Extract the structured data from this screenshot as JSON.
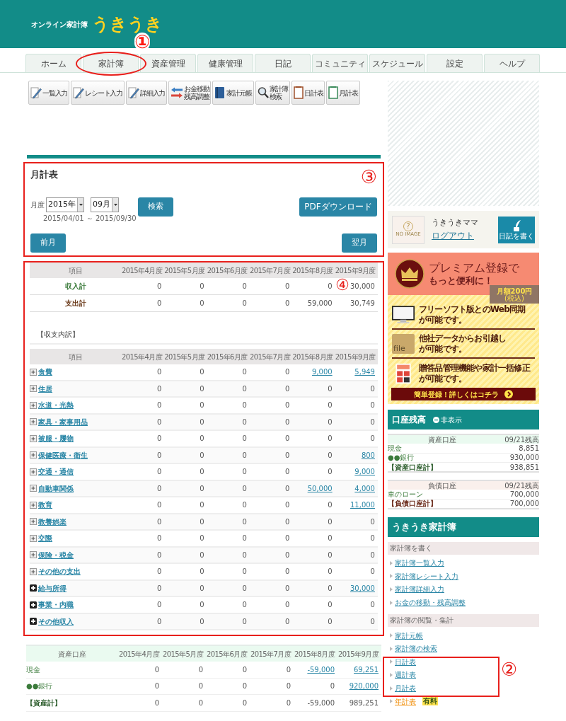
{
  "header": {
    "subtitle": "オンライン家計簿",
    "logo": "うきうき"
  },
  "tabs": [
    {
      "label": "ホーム"
    },
    {
      "label": "家計簿"
    },
    {
      "label": "資産管理"
    },
    {
      "label": "健康管理"
    },
    {
      "label": "日記"
    },
    {
      "label": "コミュニティ"
    },
    {
      "label": "スケジュール"
    },
    {
      "label": "設定"
    },
    {
      "label": "ヘルプ"
    }
  ],
  "toolbar": [
    {
      "kind": "pencil",
      "lines": [
        "一覧入力"
      ]
    },
    {
      "kind": "pencil",
      "lines": [
        "レシート入力"
      ]
    },
    {
      "kind": "pencil",
      "lines": [
        "詳細入力"
      ]
    },
    {
      "kind": "transfer",
      "lines": [
        "お金移動",
        "残高調整"
      ]
    },
    {
      "kind": "ledger",
      "lines": [
        "家計元帳"
      ]
    },
    {
      "kind": "search",
      "lines": [
        "家計簿",
        "検索"
      ]
    },
    {
      "kind": "daily",
      "lines": [
        "日計表"
      ]
    },
    {
      "kind": "monthly",
      "lines": [
        "月計表"
      ]
    }
  ],
  "panel": {
    "title": "月計表",
    "period_label": "月度",
    "year": "2015年",
    "month": "09月",
    "range": "2015/04/01 ～ 2015/09/30",
    "search_button": "検索",
    "pdf_button": "PDFダウンロード",
    "prev_button": "前月",
    "next_button": "翌月"
  },
  "summary": {
    "header": "項目",
    "columns": [
      "2015年4月度",
      "2015年5月度",
      "2015年6月度",
      "2015年7月度",
      "2015年8月度",
      "2015年9月度"
    ],
    "rows": [
      {
        "label": "収入計",
        "kind": "income",
        "values": [
          "0",
          "0",
          "0",
          "0",
          "0",
          "30,000"
        ]
      },
      {
        "label": "支出計",
        "kind": "expense",
        "values": [
          "0",
          "0",
          "0",
          "0",
          "59,000",
          "30,749"
        ]
      }
    ]
  },
  "breakdown": {
    "title": "【収支内訳】",
    "header": "項目",
    "columns": [
      "2015年4月度",
      "2015年5月度",
      "2015年6月度",
      "2015年7月度",
      "2015年8月度",
      "2015年9月度"
    ],
    "rows": [
      {
        "label": "食費",
        "kind": "expense",
        "values": [
          "0",
          "0",
          "0",
          "0",
          "9,000",
          "5,949"
        ],
        "linked": [
          false,
          false,
          false,
          false,
          true,
          true
        ]
      },
      {
        "label": "住居",
        "kind": "expense",
        "values": [
          "0",
          "0",
          "0",
          "0",
          "0",
          "0"
        ],
        "linked": [
          false,
          false,
          false,
          false,
          false,
          false
        ]
      },
      {
        "label": "水道・光熱",
        "kind": "expense",
        "values": [
          "0",
          "0",
          "0",
          "0",
          "0",
          "0"
        ],
        "linked": [
          false,
          false,
          false,
          false,
          false,
          false
        ]
      },
      {
        "label": "家具・家事用品",
        "kind": "expense",
        "values": [
          "0",
          "0",
          "0",
          "0",
          "0",
          "0"
        ],
        "linked": [
          false,
          false,
          false,
          false,
          false,
          false
        ]
      },
      {
        "label": "被服・履物",
        "kind": "expense",
        "values": [
          "0",
          "0",
          "0",
          "0",
          "0",
          "0"
        ],
        "linked": [
          false,
          false,
          false,
          false,
          false,
          false
        ]
      },
      {
        "label": "保健医療・衛生",
        "kind": "expense",
        "values": [
          "0",
          "0",
          "0",
          "0",
          "0",
          "800"
        ],
        "linked": [
          false,
          false,
          false,
          false,
          false,
          true
        ]
      },
      {
        "label": "交通・通信",
        "kind": "expense",
        "values": [
          "0",
          "0",
          "0",
          "0",
          "0",
          "9,000"
        ],
        "linked": [
          false,
          false,
          false,
          false,
          false,
          true
        ]
      },
      {
        "label": "自動車関係",
        "kind": "expense",
        "values": [
          "0",
          "0",
          "0",
          "0",
          "50,000",
          "4,000"
        ],
        "linked": [
          false,
          false,
          false,
          false,
          true,
          true
        ]
      },
      {
        "label": "教育",
        "kind": "expense",
        "values": [
          "0",
          "0",
          "0",
          "0",
          "0",
          "11,000"
        ],
        "linked": [
          false,
          false,
          false,
          false,
          false,
          true
        ]
      },
      {
        "label": "教養娯楽",
        "kind": "expense",
        "values": [
          "0",
          "0",
          "0",
          "0",
          "0",
          "0"
        ],
        "linked": [
          false,
          false,
          false,
          false,
          false,
          false
        ]
      },
      {
        "label": "交際",
        "kind": "expense",
        "values": [
          "0",
          "0",
          "0",
          "0",
          "0",
          "0"
        ],
        "linked": [
          false,
          false,
          false,
          false,
          false,
          false
        ]
      },
      {
        "label": "保険・税金",
        "kind": "expense",
        "values": [
          "0",
          "0",
          "0",
          "0",
          "0",
          "0"
        ],
        "linked": [
          false,
          false,
          false,
          false,
          false,
          false
        ]
      },
      {
        "label": "その他の支出",
        "kind": "expense",
        "values": [
          "0",
          "0",
          "0",
          "0",
          "0",
          "0"
        ],
        "linked": [
          false,
          false,
          false,
          false,
          false,
          false
        ]
      },
      {
        "label": "給与所得",
        "kind": "income",
        "values": [
          "0",
          "0",
          "0",
          "0",
          "0",
          "30,000"
        ],
        "linked": [
          false,
          false,
          false,
          false,
          false,
          true
        ]
      },
      {
        "label": "事業・内職",
        "kind": "income",
        "values": [
          "0",
          "0",
          "0",
          "0",
          "0",
          "0"
        ],
        "linked": [
          false,
          false,
          false,
          false,
          false,
          false
        ]
      },
      {
        "label": "その他収入",
        "kind": "income",
        "values": [
          "0",
          "0",
          "0",
          "0",
          "0",
          "0"
        ],
        "linked": [
          false,
          false,
          false,
          false,
          false,
          false
        ]
      }
    ]
  },
  "assets": {
    "header": "資産口座",
    "columns": [
      "2015年4月度",
      "2015年5月度",
      "2015年6月度",
      "2015年7月度",
      "2015年8月度",
      "2015年9月度"
    ],
    "rows": [
      {
        "label": "現金",
        "kind": "account",
        "values": [
          "0",
          "0",
          "0",
          "0",
          "-59,000",
          "69,251"
        ],
        "linked": [
          false,
          false,
          false,
          false,
          true,
          true
        ]
      },
      {
        "label": "●●銀行",
        "kind": "account",
        "values": [
          "0",
          "0",
          "0",
          "0",
          "0",
          "920,000"
        ],
        "linked": [
          false,
          false,
          false,
          false,
          false,
          true
        ]
      },
      {
        "label": "【資産計】",
        "kind": "total",
        "values": [
          "0",
          "0",
          "0",
          "0",
          "-59,000",
          "989,251"
        ],
        "linked": [
          false,
          false,
          false,
          false,
          false,
          false
        ]
      }
    ]
  },
  "user": {
    "avatar_mark": "?",
    "avatar_text": "NO IMAGE",
    "name": "うきうきママ",
    "logout": "ログアウト",
    "diary_button": "日記を書く"
  },
  "premium": {
    "title": "プレミアム登録で",
    "subtitle": "もっと便利に！",
    "price": "月額200円",
    "tax": "(税込)",
    "features": [
      {
        "kind": "monitor",
        "lines": [
          "フリーソフト版とのWeb同期",
          "が可能です。"
        ]
      },
      {
        "kind": "folder",
        "folder_label": "file",
        "lines": [
          "他社データからお引越し",
          "が可能です。"
        ]
      },
      {
        "kind": "calculator",
        "lines": [
          "贈答品管理機能や家計一括修正",
          "が可能です。"
        ]
      }
    ],
    "cta": "簡単登録！詳しくはコチラ"
  },
  "balances": {
    "title": "口座残高",
    "hide": "非表示",
    "tables": [
      {
        "kind": "asset",
        "header": "資産口座",
        "date": "09/21残高",
        "rows": [
          {
            "label": "現金",
            "value": "8,851"
          },
          {
            "label": "●●銀行",
            "value": "930,000"
          }
        ],
        "total": {
          "label": "【資産口座計】",
          "value": "938,851"
        }
      },
      {
        "kind": "liability",
        "header": "負債口座",
        "date": "09/21残高",
        "rows": [
          {
            "label": "車のローン",
            "value": "700,000"
          }
        ],
        "total": {
          "label": "【負債口座計】",
          "value": "700,000"
        }
      }
    ]
  },
  "menu": {
    "title": "うきうき家計簿",
    "sections": [
      {
        "heading": "家計簿を書く",
        "links": [
          {
            "label": "家計簿一覧入力",
            "kind": "free"
          },
          {
            "label": "家計簿レシート入力",
            "kind": "free"
          },
          {
            "label": "家計簿詳細入力",
            "kind": "free"
          },
          {
            "label": "お金の移動・残高調整",
            "kind": "free"
          }
        ]
      },
      {
        "heading": "家計簿の閲覧・集計",
        "links": [
          {
            "label": "家計元帳",
            "kind": "free"
          },
          {
            "label": "家計簿の検索",
            "kind": "free"
          },
          {
            "label": "日計表",
            "kind": "free"
          },
          {
            "label": "週計表",
            "kind": "free"
          },
          {
            "label": "月計表",
            "kind": "free"
          },
          {
            "label": "年計表",
            "kind": "paid",
            "badge": "有料"
          }
        ]
      }
    ]
  },
  "annotations": [
    {
      "label": "①"
    },
    {
      "label": "②"
    },
    {
      "label": "③"
    },
    {
      "label": "④"
    }
  ]
}
